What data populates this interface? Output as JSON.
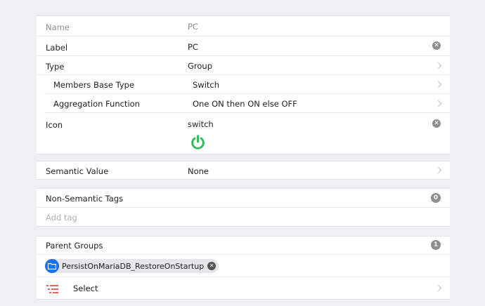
{
  "item_form": {
    "name": {
      "label": "Name",
      "value": "PC"
    },
    "label_field": {
      "label": "Label",
      "value": "PC"
    },
    "type": {
      "label": "Type",
      "value": "Group"
    },
    "members_base_type": {
      "label": "Members Base Type",
      "value": "Switch"
    },
    "aggregation_function": {
      "label": "Aggregation Function",
      "value": "One ON then ON else OFF"
    },
    "icon": {
      "label": "Icon",
      "value": "switch",
      "preview_icon": "power-icon",
      "preview_color": "#2ebd59"
    }
  },
  "semantics": {
    "label": "Semantic Value",
    "value": "None"
  },
  "tags": {
    "label": "Non-Semantic Tags",
    "count": "0",
    "add_placeholder": "Add tag"
  },
  "parent_groups": {
    "label": "Parent Groups",
    "count": "1",
    "chips": [
      {
        "label": "PersistOnMariaDB_RestoreOnStartup",
        "icon": "folder-icon",
        "color": "#1a73e8"
      }
    ],
    "select_label": "Select",
    "select_icon": "list-icon",
    "select_icon_color": "#e53935"
  },
  "icons": {
    "clear": "⊗"
  }
}
